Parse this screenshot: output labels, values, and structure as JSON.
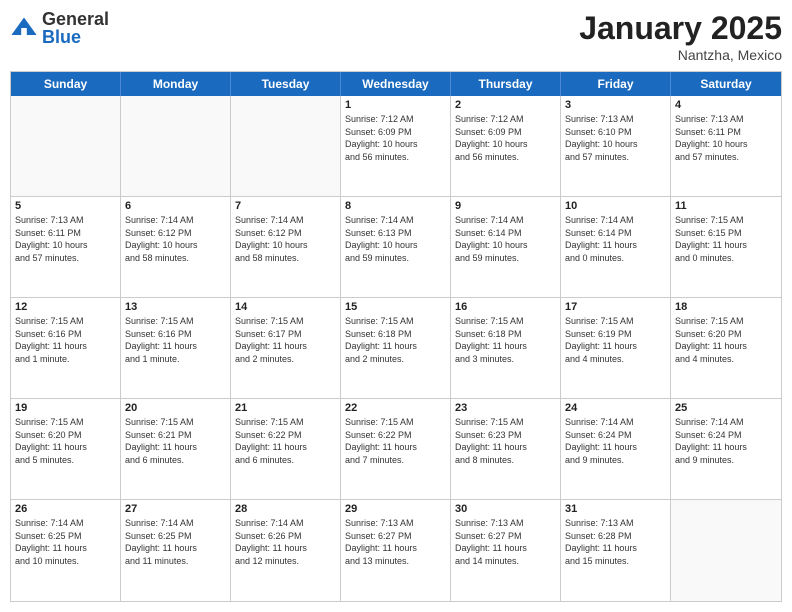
{
  "header": {
    "logo_general": "General",
    "logo_blue": "Blue",
    "month_title": "January 2025",
    "location": "Nantzha, Mexico"
  },
  "days_of_week": [
    "Sunday",
    "Monday",
    "Tuesday",
    "Wednesday",
    "Thursday",
    "Friday",
    "Saturday"
  ],
  "rows": [
    [
      {
        "day": "",
        "info": "",
        "empty": true
      },
      {
        "day": "",
        "info": "",
        "empty": true
      },
      {
        "day": "",
        "info": "",
        "empty": true
      },
      {
        "day": "1",
        "info": "Sunrise: 7:12 AM\nSunset: 6:09 PM\nDaylight: 10 hours\nand 56 minutes.",
        "empty": false
      },
      {
        "day": "2",
        "info": "Sunrise: 7:12 AM\nSunset: 6:09 PM\nDaylight: 10 hours\nand 56 minutes.",
        "empty": false
      },
      {
        "day": "3",
        "info": "Sunrise: 7:13 AM\nSunset: 6:10 PM\nDaylight: 10 hours\nand 57 minutes.",
        "empty": false
      },
      {
        "day": "4",
        "info": "Sunrise: 7:13 AM\nSunset: 6:11 PM\nDaylight: 10 hours\nand 57 minutes.",
        "empty": false
      }
    ],
    [
      {
        "day": "5",
        "info": "Sunrise: 7:13 AM\nSunset: 6:11 PM\nDaylight: 10 hours\nand 57 minutes.",
        "empty": false
      },
      {
        "day": "6",
        "info": "Sunrise: 7:14 AM\nSunset: 6:12 PM\nDaylight: 10 hours\nand 58 minutes.",
        "empty": false
      },
      {
        "day": "7",
        "info": "Sunrise: 7:14 AM\nSunset: 6:12 PM\nDaylight: 10 hours\nand 58 minutes.",
        "empty": false
      },
      {
        "day": "8",
        "info": "Sunrise: 7:14 AM\nSunset: 6:13 PM\nDaylight: 10 hours\nand 59 minutes.",
        "empty": false
      },
      {
        "day": "9",
        "info": "Sunrise: 7:14 AM\nSunset: 6:14 PM\nDaylight: 10 hours\nand 59 minutes.",
        "empty": false
      },
      {
        "day": "10",
        "info": "Sunrise: 7:14 AM\nSunset: 6:14 PM\nDaylight: 11 hours\nand 0 minutes.",
        "empty": false
      },
      {
        "day": "11",
        "info": "Sunrise: 7:15 AM\nSunset: 6:15 PM\nDaylight: 11 hours\nand 0 minutes.",
        "empty": false
      }
    ],
    [
      {
        "day": "12",
        "info": "Sunrise: 7:15 AM\nSunset: 6:16 PM\nDaylight: 11 hours\nand 1 minute.",
        "empty": false
      },
      {
        "day": "13",
        "info": "Sunrise: 7:15 AM\nSunset: 6:16 PM\nDaylight: 11 hours\nand 1 minute.",
        "empty": false
      },
      {
        "day": "14",
        "info": "Sunrise: 7:15 AM\nSunset: 6:17 PM\nDaylight: 11 hours\nand 2 minutes.",
        "empty": false
      },
      {
        "day": "15",
        "info": "Sunrise: 7:15 AM\nSunset: 6:18 PM\nDaylight: 11 hours\nand 2 minutes.",
        "empty": false
      },
      {
        "day": "16",
        "info": "Sunrise: 7:15 AM\nSunset: 6:18 PM\nDaylight: 11 hours\nand 3 minutes.",
        "empty": false
      },
      {
        "day": "17",
        "info": "Sunrise: 7:15 AM\nSunset: 6:19 PM\nDaylight: 11 hours\nand 4 minutes.",
        "empty": false
      },
      {
        "day": "18",
        "info": "Sunrise: 7:15 AM\nSunset: 6:20 PM\nDaylight: 11 hours\nand 4 minutes.",
        "empty": false
      }
    ],
    [
      {
        "day": "19",
        "info": "Sunrise: 7:15 AM\nSunset: 6:20 PM\nDaylight: 11 hours\nand 5 minutes.",
        "empty": false
      },
      {
        "day": "20",
        "info": "Sunrise: 7:15 AM\nSunset: 6:21 PM\nDaylight: 11 hours\nand 6 minutes.",
        "empty": false
      },
      {
        "day": "21",
        "info": "Sunrise: 7:15 AM\nSunset: 6:22 PM\nDaylight: 11 hours\nand 6 minutes.",
        "empty": false
      },
      {
        "day": "22",
        "info": "Sunrise: 7:15 AM\nSunset: 6:22 PM\nDaylight: 11 hours\nand 7 minutes.",
        "empty": false
      },
      {
        "day": "23",
        "info": "Sunrise: 7:15 AM\nSunset: 6:23 PM\nDaylight: 11 hours\nand 8 minutes.",
        "empty": false
      },
      {
        "day": "24",
        "info": "Sunrise: 7:14 AM\nSunset: 6:24 PM\nDaylight: 11 hours\nand 9 minutes.",
        "empty": false
      },
      {
        "day": "25",
        "info": "Sunrise: 7:14 AM\nSunset: 6:24 PM\nDaylight: 11 hours\nand 9 minutes.",
        "empty": false
      }
    ],
    [
      {
        "day": "26",
        "info": "Sunrise: 7:14 AM\nSunset: 6:25 PM\nDaylight: 11 hours\nand 10 minutes.",
        "empty": false
      },
      {
        "day": "27",
        "info": "Sunrise: 7:14 AM\nSunset: 6:25 PM\nDaylight: 11 hours\nand 11 minutes.",
        "empty": false
      },
      {
        "day": "28",
        "info": "Sunrise: 7:14 AM\nSunset: 6:26 PM\nDaylight: 11 hours\nand 12 minutes.",
        "empty": false
      },
      {
        "day": "29",
        "info": "Sunrise: 7:13 AM\nSunset: 6:27 PM\nDaylight: 11 hours\nand 13 minutes.",
        "empty": false
      },
      {
        "day": "30",
        "info": "Sunrise: 7:13 AM\nSunset: 6:27 PM\nDaylight: 11 hours\nand 14 minutes.",
        "empty": false
      },
      {
        "day": "31",
        "info": "Sunrise: 7:13 AM\nSunset: 6:28 PM\nDaylight: 11 hours\nand 15 minutes.",
        "empty": false
      },
      {
        "day": "",
        "info": "",
        "empty": true
      }
    ]
  ]
}
